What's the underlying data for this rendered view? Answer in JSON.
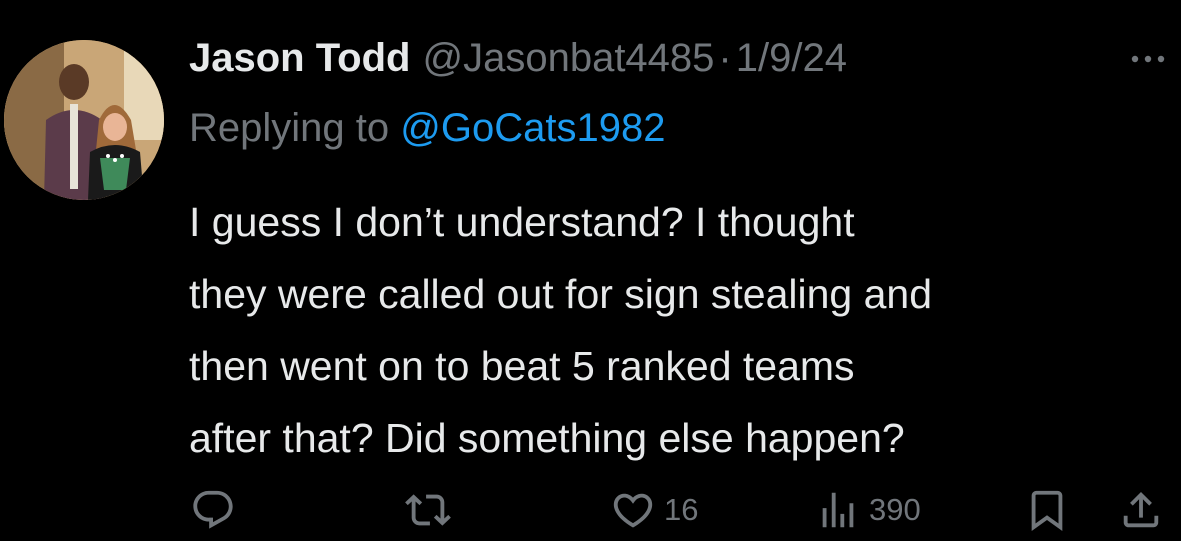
{
  "user": {
    "display_name": "Jason Todd",
    "handle": "@Jasonbat4485",
    "separator": "·",
    "date": "1/9/24",
    "avatar_icon": "profile-photo"
  },
  "reply": {
    "prefix": "Replying to",
    "to_handle": "@GoCats1982"
  },
  "tweet": {
    "lines": [
      "I guess I don’t understand? I thought",
      "they were called out for sign stealing and",
      "then went on to beat 5 ranked teams",
      "after that?  Did something else happen?"
    ]
  },
  "actions": {
    "reply_icon": "reply-icon",
    "retweet_icon": "retweet-icon",
    "like_icon": "heart-icon",
    "likes": "16",
    "views_icon": "analytics-icon",
    "views": "390",
    "bookmark_icon": "bookmark-icon",
    "share_icon": "share-icon"
  },
  "colors": {
    "background": "#000000",
    "text": "#e7e9ea",
    "muted": "#71767b",
    "link": "#1d9bf0"
  }
}
